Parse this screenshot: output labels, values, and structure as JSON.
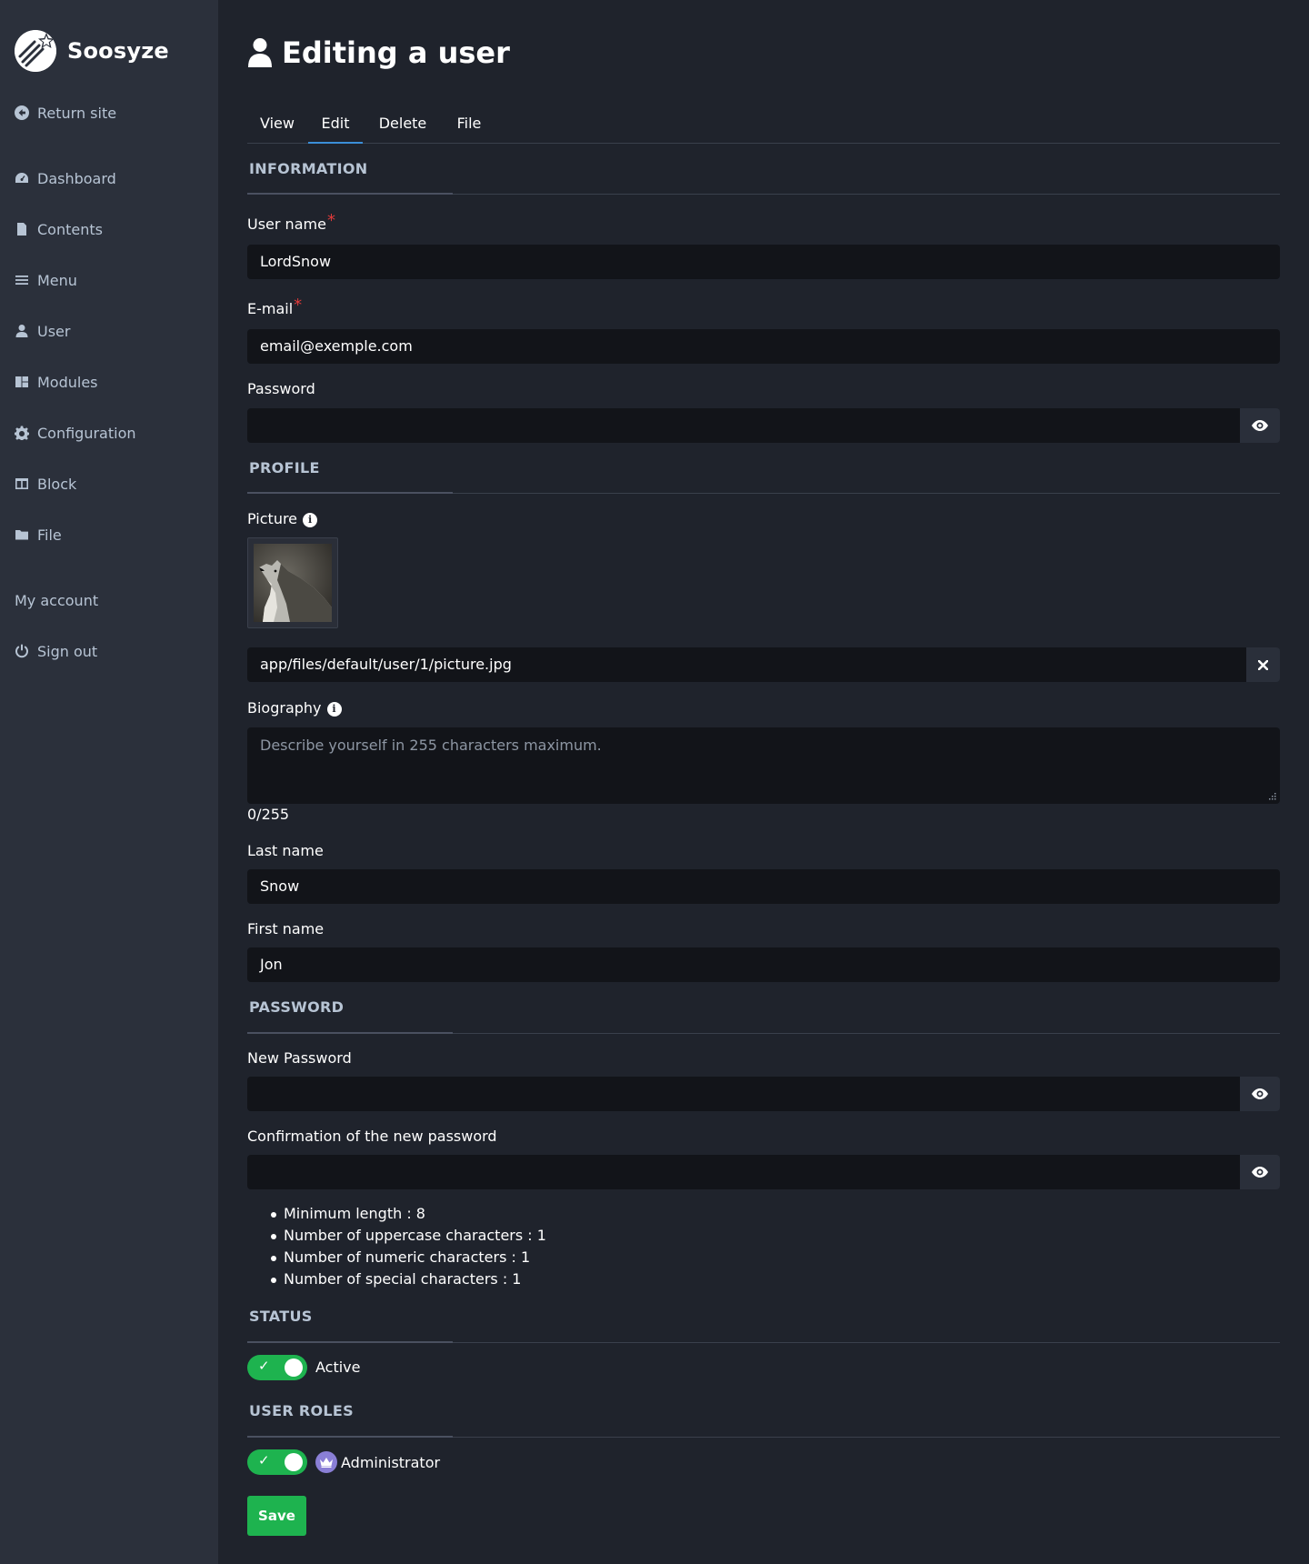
{
  "sidebar": {
    "brand": {
      "name": "Soosyze",
      "logo_icon": "shooting-star-logo"
    },
    "return_site": "Return site",
    "items": [
      {
        "label": "Dashboard",
        "icon": "gauge-icon"
      },
      {
        "label": "Contents",
        "icon": "file-icon"
      },
      {
        "label": "Menu",
        "icon": "bars-icon"
      },
      {
        "label": "User",
        "icon": "user-icon"
      },
      {
        "label": "Modules",
        "icon": "cubes-icon"
      },
      {
        "label": "Configuration",
        "icon": "gear-icon"
      },
      {
        "label": "Block",
        "icon": "columns-icon"
      },
      {
        "label": "File",
        "icon": "folder-icon"
      }
    ],
    "my_account": "My account",
    "sign_out": "Sign out"
  },
  "header": {
    "title": "Editing a user",
    "icon": "user-icon"
  },
  "tabs": [
    {
      "label": "View",
      "active": false
    },
    {
      "label": "Edit",
      "active": true
    },
    {
      "label": "Delete",
      "active": false
    },
    {
      "label": "File",
      "active": false
    }
  ],
  "form": {
    "information": {
      "title": "INFORMATION",
      "username": {
        "label": "User name",
        "required": "*",
        "value": "LordSnow"
      },
      "email": {
        "label": "E-mail",
        "required": "*",
        "value": "email@exemple.com"
      },
      "password": {
        "label": "Password",
        "value": ""
      }
    },
    "profile": {
      "title": "PROFILE",
      "picture": {
        "label": "Picture",
        "path": "app/files/default/user/1/picture.jpg"
      },
      "biography": {
        "label": "Biography",
        "placeholder": "Describe yourself in 255 characters maximum.",
        "counter": "0/255"
      },
      "last_name": {
        "label": "Last name",
        "value": "Snow"
      },
      "first_name": {
        "label": "First name",
        "value": "Jon"
      }
    },
    "password_section": {
      "title": "PASSWORD",
      "new_password": {
        "label": "New Password",
        "value": ""
      },
      "confirm_password": {
        "label": "Confirmation of the new password",
        "value": ""
      },
      "rules": [
        "Minimum length : 8",
        "Number of uppercase characters : 1",
        "Number of numeric characters : 1",
        "Number of special characters : 1"
      ]
    },
    "status": {
      "title": "STATUS",
      "active_label": "Active",
      "active": true
    },
    "roles": {
      "title": "USER ROLES",
      "items": [
        {
          "label": "Administrator",
          "checked": true,
          "icon": "crown-icon",
          "color": "#8a7fd6"
        }
      ]
    },
    "save_label": "Save"
  },
  "colors": {
    "accent": "#1eb34f",
    "tab_active": "#3b8fd9",
    "required": "#e03a3a"
  }
}
